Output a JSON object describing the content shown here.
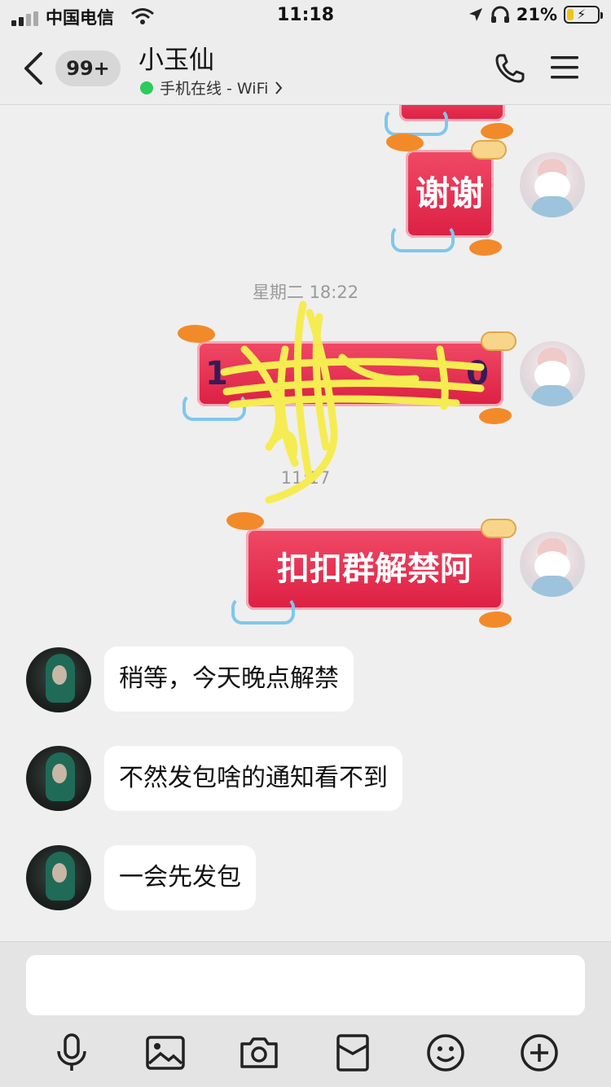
{
  "status_bar": {
    "carrier": "中国电信",
    "time": "11:18",
    "battery_percent_label": "21%",
    "battery_level": 0.21,
    "icons": [
      "signal-icon",
      "wifi-icon",
      "location-arrow-icon",
      "headphones-icon",
      "battery-charging-icon"
    ]
  },
  "header": {
    "unread_badge": "99+",
    "contact_name": "小玉仙",
    "presence": "手机在线 - WiFi",
    "presence_color": "#2ccb5c",
    "icons": [
      "back-chevron-icon",
      "phone-call-icon",
      "menu-icon",
      "chevron-right-icon"
    ]
  },
  "messages": {
    "sticker_thanks": "谢谢",
    "timestamp_1": "星期二 18:22",
    "sticker_redacted_text": "1",
    "sticker_redacted_tail": "0",
    "timestamp_2": "11:17",
    "sticker_unban": "扣扣群解禁阿",
    "reply_1": "稍等，今天晚点解禁",
    "reply_2": "不然发包啥的通知看不到",
    "reply_3": "一会先发包"
  },
  "colors": {
    "sticker_red": "#dc1f43",
    "scribble_yellow": "#f5ec52",
    "bubble_bg": "#ffffff",
    "chat_bg": "#efefef"
  },
  "input_bar": {
    "tools": [
      "microphone-icon",
      "image-icon",
      "camera-icon",
      "red-packet-icon",
      "emoji-icon",
      "plus-icon"
    ]
  }
}
